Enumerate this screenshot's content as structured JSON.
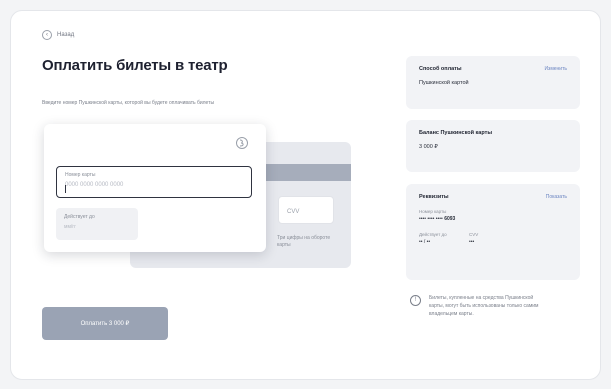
{
  "header": {
    "back_label": "Назад",
    "title": "Оплатить билеты в театр",
    "subtitle": "Введите номер Пушкинской карты, которой вы будете оплачивать билеты"
  },
  "card_form": {
    "number_label": "Номер карты",
    "number_placeholder": "0000 0000 0000 0000",
    "expiry_label": "Действует до",
    "expiry_placeholder": "мм/гг",
    "cvv_label": "CVV",
    "cvv_hint": "Три цифры на обороте карты"
  },
  "pay_button": {
    "label": "Оплатить 3 000 ₽"
  },
  "summary": {
    "payment_method": {
      "title": "Способ оплаты",
      "action": "Изменить",
      "value": "Пушкинской картой"
    },
    "balance": {
      "title": "Баланс Пушкинской карты",
      "value": "3 000 ₽"
    },
    "requisites": {
      "title": "Реквизиты",
      "action": "Показать",
      "number_label": "Номер карты",
      "number_masked": "•••• •••• •••• ",
      "number_last": "6093",
      "expiry_label": "Действует до",
      "expiry_value": "•• / ••",
      "cvv_label": "CVV",
      "cvv_value": "•••"
    }
  },
  "note": {
    "text": "Билеты, купленные на средства Пушкинской карты, могут быть использованы только самим владельцем карты."
  },
  "icons": [
    "arrow-left-icon",
    "card-logo-icon",
    "info-icon"
  ]
}
